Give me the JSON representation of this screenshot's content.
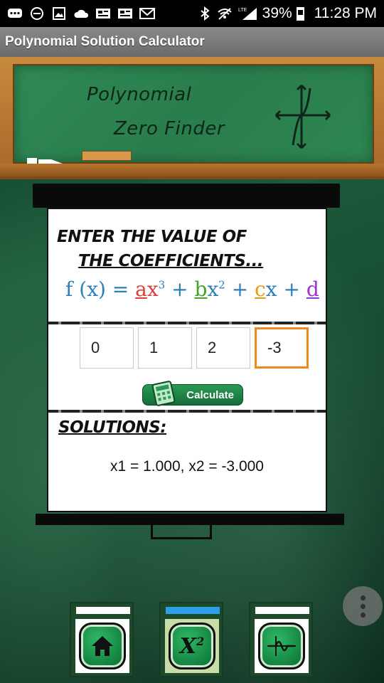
{
  "status_bar": {
    "battery": "39%",
    "time": "11:28 PM",
    "network": "LTE"
  },
  "app": {
    "title": "Polynomial Solution Calculator"
  },
  "board": {
    "line1": "Polynomial",
    "line2": "Zero Finder"
  },
  "form": {
    "heading_line1": "ENTER THE VALUE OF",
    "heading_line2": "THE COEFFICIENTS...",
    "formula": {
      "f": "f (x) =",
      "a": "a",
      "x3": "x",
      "exp3": "3",
      "plus1": "+",
      "b": "b",
      "x2": "x",
      "exp2": "2",
      "plus2": "+",
      "c": "c",
      "x1": "x",
      "plus3": "+",
      "d": "d"
    },
    "coefficients": [
      "0",
      "1",
      "2",
      "-3"
    ],
    "calculate_label": "Calculate",
    "solutions_heading": "SOLUTIONS:",
    "solutions_result": "x1 = 1.000, x2 = -3.000"
  },
  "nav": {
    "tabs": [
      {
        "icon": "home-icon",
        "label": ""
      },
      {
        "icon": "x-squared-icon",
        "label": "X",
        "sup": "2"
      },
      {
        "icon": "graph-icon",
        "label": ""
      }
    ]
  },
  "colors": {
    "accent_orange": "#f0891d",
    "nav_active": "#2aa1e8",
    "button_green": "#178a45"
  }
}
